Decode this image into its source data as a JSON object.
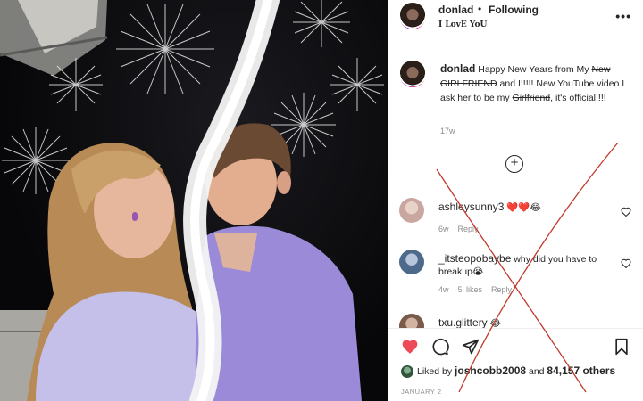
{
  "post": {
    "username": "donlad",
    "follow_dot": "•",
    "follow_status": "Following",
    "location": "I LovE YoU",
    "more_icon": "more-dots-icon"
  },
  "caption": {
    "username": "donlad",
    "text_1": " Happy New Years from My ",
    "struck_1": "New GIRLFRIEND",
    "text_2": " and I!!!!! New YouTube video I ask her to be my ",
    "struck_2": "Girlfriend",
    "text_3": ", it's official!!!!",
    "time": "17w"
  },
  "load_more": "+",
  "comments": [
    {
      "username": "ashleysunny3",
      "text": " ❤️❤️😂",
      "time": "6w",
      "likes": "",
      "reply": "Reply",
      "avatar_color": "#c9a7a0"
    },
    {
      "username": "_itsteopobaybe",
      "text": " why did you have to breakup😭",
      "time": "4w",
      "likes": "5 likes",
      "reply": "Reply",
      "avatar_color": "#4d6a8a"
    },
    {
      "username": "txu.glittery",
      "text": " 😂",
      "time": "",
      "likes": "",
      "reply": "",
      "avatar_color": "#7a5a4a"
    }
  ],
  "likes": {
    "prefix": "Liked by ",
    "user": "joshcobb2008",
    "mid": " and ",
    "count": "84,157 others"
  },
  "date": "JANUARY 2",
  "colors": {
    "heart": "#ed4956",
    "x_mark": "#c0392b"
  }
}
